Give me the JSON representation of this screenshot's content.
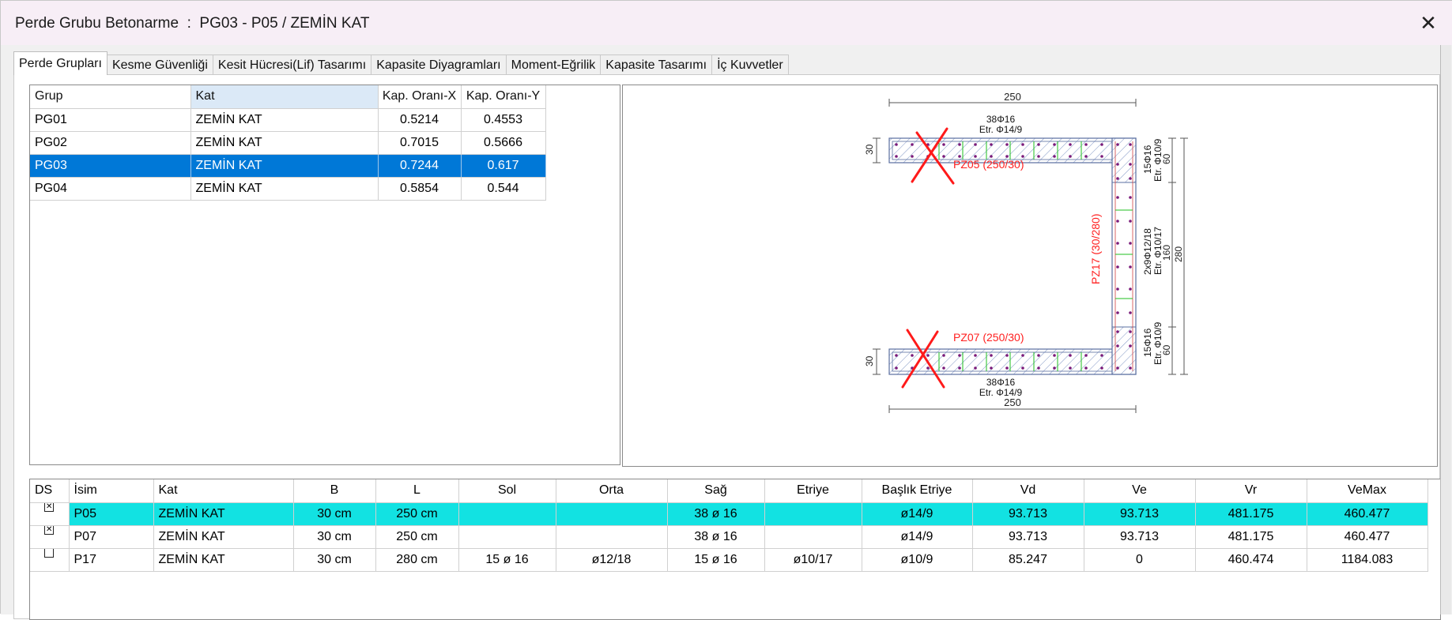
{
  "window": {
    "title": "Perde Grubu Betonarme  :  PG03 - P05 / ZEMİN KAT",
    "close_glyph": "✕"
  },
  "tabs": [
    {
      "label": "Perde Grupları",
      "active": true
    },
    {
      "label": "Kesme Güvenliği",
      "active": false
    },
    {
      "label": "Kesit Hücresi(Lif) Tasarımı",
      "active": false
    },
    {
      "label": "Kapasite Diyagramları",
      "active": false
    },
    {
      "label": "Moment-Eğrilik",
      "active": false
    },
    {
      "label": "Kapasite Tasarımı",
      "active": false
    },
    {
      "label": "İç Kuvvetler",
      "active": false
    }
  ],
  "groups_table": {
    "columns": [
      "Grup",
      "Kat",
      "Kap. Oranı-X",
      "Kap. Oranı-Y"
    ],
    "rows": [
      {
        "grup": "PG01",
        "kat": "ZEMİN KAT",
        "x": "0.5214",
        "y": "0.4553",
        "selected": false
      },
      {
        "grup": "PG02",
        "kat": "ZEMİN KAT",
        "x": "0.7015",
        "y": "0.5666",
        "selected": false
      },
      {
        "grup": "PG03",
        "kat": "ZEMİN KAT",
        "x": "0.7244",
        "y": "0.617",
        "selected": true
      },
      {
        "grup": "PG04",
        "kat": "ZEMİN KAT",
        "x": "0.5854",
        "y": "0.544",
        "selected": false
      }
    ]
  },
  "drawing": {
    "top_width": "250",
    "bottom_width": "250",
    "top_thickness": "30",
    "bottom_thickness": "30",
    "right_dim_top": "60",
    "right_dim_mid": "160",
    "right_dim_bottom": "60",
    "right_dim_total": "280",
    "top_rebar": "38Φ16",
    "top_stirrup": "Etr. Φ14/9",
    "bottom_rebar": "38Φ16",
    "bottom_stirrup": "Etr. Φ14/9",
    "right_top_rebar": "15Φ16",
    "right_top_stirrup": "Etr. Φ10/9",
    "right_mid_rebar": "2x9Φ12/18",
    "right_mid_stirrup": "Etr. Φ10/17",
    "right_bottom_rebar": "15Φ16",
    "right_bottom_stirrup": "Etr. Φ10/9",
    "label_pz05": "PZ05 (250/30)",
    "label_pz07": "PZ07 (250/30)",
    "label_pz17": "PZ17 (30/280)",
    "colors": {
      "red_label": "#ff2020",
      "cross": "#ff1a1a",
      "rebar": "#7a1a7a",
      "hatch": "#5a6fa0"
    }
  },
  "walls_table": {
    "columns": [
      "DS",
      "İsim",
      "Kat",
      "B",
      "L",
      "Sol",
      "Orta",
      "Sağ",
      "Etriye",
      "Başlık Etriye",
      "Vd",
      "Ve",
      "Vr",
      "VeMax"
    ],
    "rows": [
      {
        "checked": true,
        "isim": "P05",
        "kat": "ZEMİN KAT",
        "b": "30 cm",
        "l": "250 cm",
        "sol": "",
        "orta": "",
        "sag": "38 ø 16",
        "etriye": "",
        "baslik": "ø14/9",
        "vd": "93.713",
        "ve": "93.713",
        "vr": "481.175",
        "vemax": "460.477",
        "highlight": true
      },
      {
        "checked": true,
        "isim": "P07",
        "kat": "ZEMİN KAT",
        "b": "30 cm",
        "l": "250 cm",
        "sol": "",
        "orta": "",
        "sag": "38 ø 16",
        "etriye": "",
        "baslik": "ø14/9",
        "vd": "93.713",
        "ve": "93.713",
        "vr": "481.175",
        "vemax": "460.477",
        "highlight": false
      },
      {
        "checked": false,
        "isim": "P17",
        "kat": "ZEMİN KAT",
        "b": "30 cm",
        "l": "280 cm",
        "sol": "15 ø 16",
        "orta": "ø12/18",
        "sag": "15 ø 16",
        "etriye": "ø10/17",
        "baslik": "ø10/9",
        "vd": "85.247",
        "ve": "0",
        "vr": "460.474",
        "vemax": "1184.083",
        "highlight": false
      }
    ]
  }
}
